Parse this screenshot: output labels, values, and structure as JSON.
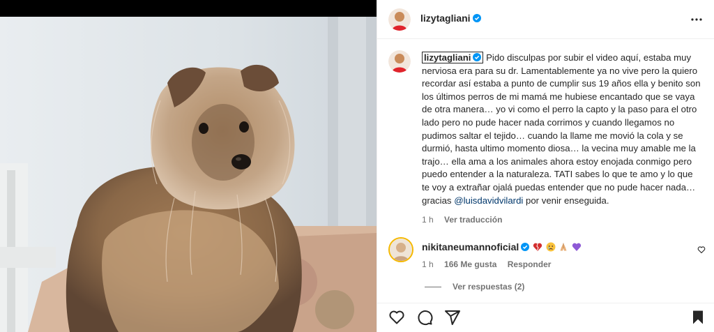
{
  "post": {
    "username": "lizytagliani",
    "verified": true
  },
  "header": {
    "more_icon": "more-horizontal-icon"
  },
  "caption": {
    "username": "lizytagliani",
    "text_part1": "Pido disculpas por subir el video aquí, estaba muy nerviosa era para su dr. Lamentablemente ya no vive pero la quiero recordar así estaba a punto de cumplir sus 19 años ella y benito son los últimos perros de mi mamá me hubiese encantado que se vaya de otra manera… yo vi como el perro la capto y la paso para el otro lado pero no pude hacer nada corrimos y cuando llegamos no pudimos saltar el tejido… cuando la llame me movió la cola y se durmió, hasta ultimo momento diosa… la vecina muy amable me la trajo… ella ama a los animales ahora estoy enojada conmigo pero puedo entender a la naturaleza. TATI sabes lo que te amo y lo que te voy a extrañar ojalá puedas entender que no pude hacer nada… gracias",
    "mention": "@luisdavidvilardi",
    "text_part2": "por venir enseguida.",
    "time": "1 h",
    "translate": "Ver traducción"
  },
  "comment": {
    "username": "nikitaneumannoficial",
    "emojis": [
      "broken-heart-icon",
      "crying-face-icon",
      "folded-hands-icon",
      "purple-heart-icon"
    ],
    "time": "1 h",
    "likes": "166 Me gusta",
    "reply": "Responder",
    "view_replies": "Ver respuestas (2)"
  },
  "actions": {
    "icons": [
      "heart-icon",
      "comment-icon",
      "share-icon",
      "bookmark-icon"
    ]
  },
  "colors": {
    "text": "#262626",
    "secondary": "#737373",
    "verified": "#0095f6",
    "mention": "#00376b"
  }
}
